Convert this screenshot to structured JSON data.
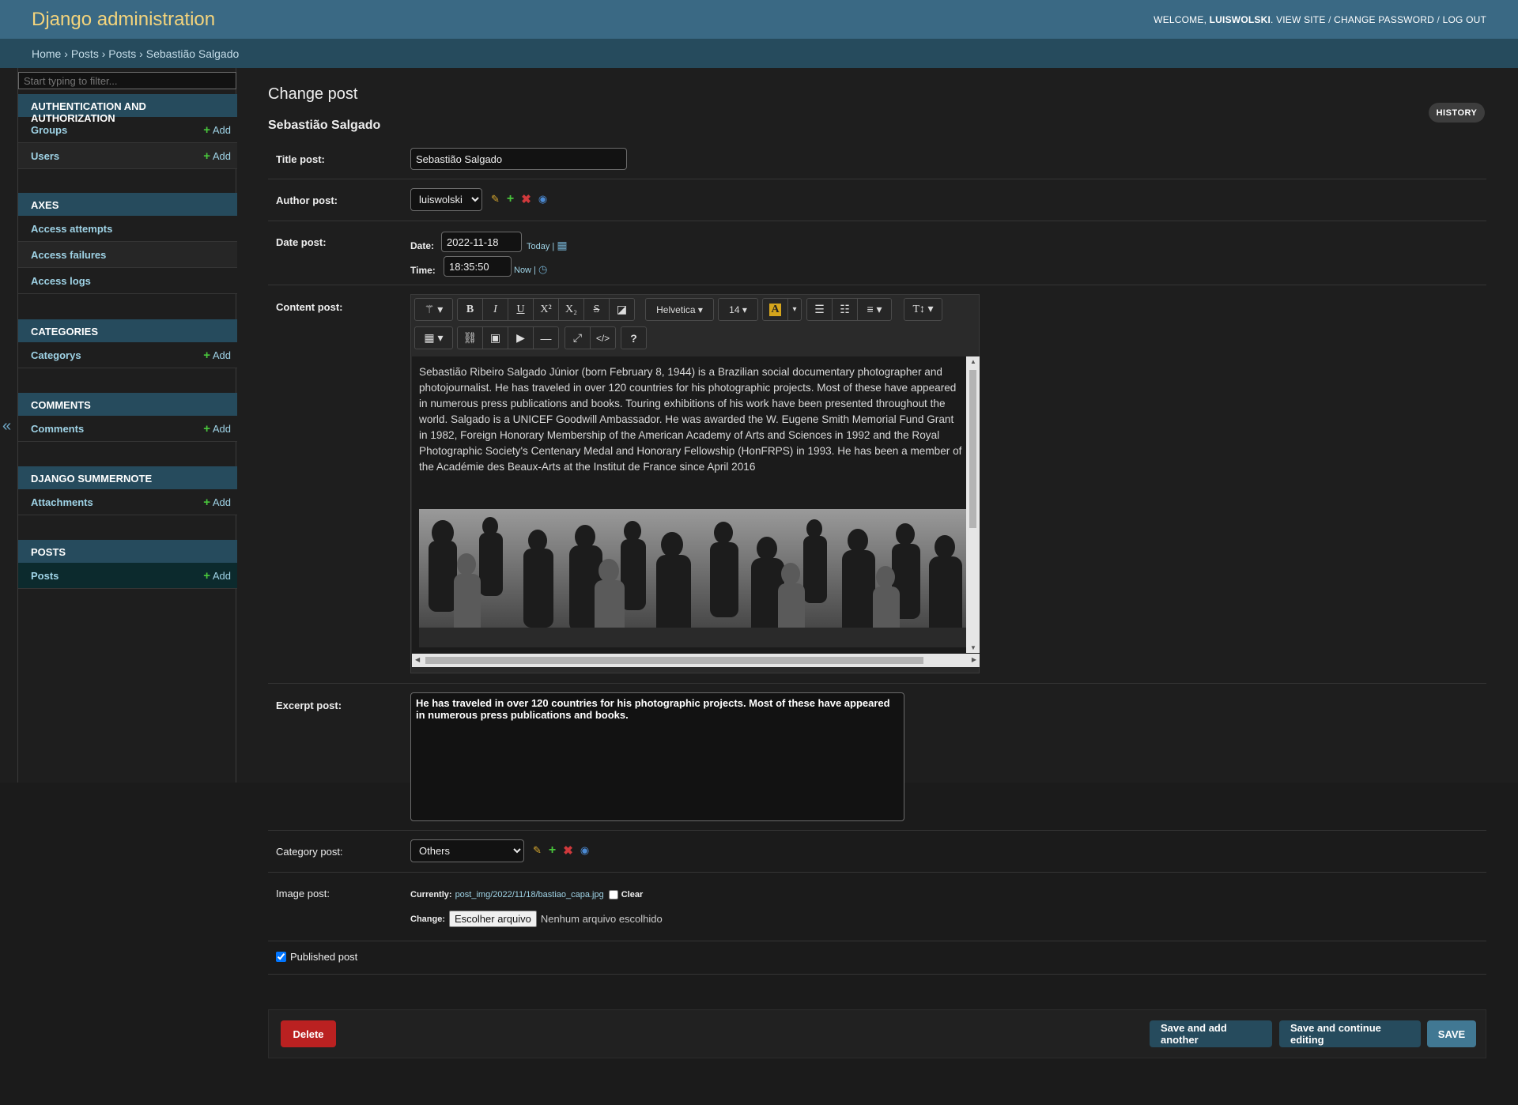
{
  "header": {
    "branding": "Django administration",
    "welcome": "WELCOME, ",
    "username": "LUISWOLSKI",
    "view_site": "VIEW SITE",
    "change_password": "CHANGE PASSWORD",
    "logout": "LOG OUT"
  },
  "breadcrumbs": [
    "Home",
    "Posts",
    "Posts",
    "Sebastião Salgado"
  ],
  "sidebar": {
    "filter_placeholder": "Start typing to filter...",
    "toggle_icon": "«",
    "modules": [
      {
        "caption": "AUTHENTICATION AND AUTHORIZATION",
        "rows": [
          {
            "name": "Groups",
            "add": "Add"
          },
          {
            "name": "Users",
            "add": "Add"
          }
        ]
      },
      {
        "caption": "AXES",
        "rows": [
          {
            "name": "Access attempts"
          },
          {
            "name": "Access failures"
          },
          {
            "name": "Access logs"
          }
        ]
      },
      {
        "caption": "CATEGORIES",
        "rows": [
          {
            "name": "Categorys",
            "add": "Add"
          }
        ]
      },
      {
        "caption": "COMMENTS",
        "rows": [
          {
            "name": "Comments",
            "add": "Add"
          }
        ]
      },
      {
        "caption": "DJANGO SUMMERNOTE",
        "rows": [
          {
            "name": "Attachments",
            "add": "Add"
          }
        ]
      },
      {
        "caption": "POSTS",
        "rows": [
          {
            "name": "Posts",
            "add": "Add"
          }
        ]
      }
    ]
  },
  "page": {
    "title": "Change post",
    "object": "Sebastião Salgado",
    "history": "HISTORY"
  },
  "form": {
    "title_label": "Title post:",
    "title_value": "Sebastião Salgado",
    "author_label": "Author post:",
    "author_value": "luiswolski",
    "date_label": "Date post:",
    "date_sub": "Date:",
    "date_value": "2022-11-18",
    "today": "Today",
    "time_sub": "Time:",
    "time_value": "18:35:50",
    "now": "Now",
    "content_label": "Content post:",
    "font_family": "Helvetica",
    "font_size": "14",
    "content_text": "Sebastião Ribeiro Salgado Júnior (born February 8, 1944) is a Brazilian social documentary photographer and photojournalist. He has traveled in over 120 countries for his photographic projects. Most of these have appeared in numerous press publications and books. Touring exhibitions of his work have been presented throughout the world. Salgado is a UNICEF Goodwill Ambassador. He was awarded the W. Eugene Smith Memorial Fund Grant in 1982, Foreign Honorary Membership of the American Academy of Arts and Sciences in 1992 and the Royal Photographic Society's Centenary Medal and Honorary Fellowship (HonFRPS) in 1993. He has been a member of the Académie des Beaux-Arts at the Institut de France since April 2016",
    "excerpt_label": "Excerpt post:",
    "excerpt_value": "He has traveled in over 120 countries for his photographic projects. Most of these have appeared in numerous press publications and books.",
    "category_label": "Category post:",
    "category_value": "Others",
    "image_label": "Image post:",
    "currently": "Currently:",
    "image_link": "post_img/2022/11/18/bastiao_capa.jpg",
    "clear": "Clear",
    "change": "Change:",
    "choose_file": "Escolher arquivo",
    "no_file": "Nenhum arquivo escolhido",
    "published_label": "Published post",
    "published_checked": true
  },
  "submit": {
    "delete": "Delete",
    "save_add": "Save and add another",
    "save_continue": "Save and continue editing",
    "save": "SAVE"
  },
  "colors": {
    "header_bg": "#3a6984",
    "breadcrumbs_bg": "#264b5d",
    "branding": "#f4d47c",
    "link": "#9fd3e6",
    "delete": "#ba2121",
    "save": "#417893"
  },
  "icons": {
    "edit": "pencil-icon",
    "add": "plus-icon",
    "delete": "x-icon",
    "view": "eye-icon",
    "calendar": "calendar-icon",
    "clock": "clock-icon"
  }
}
